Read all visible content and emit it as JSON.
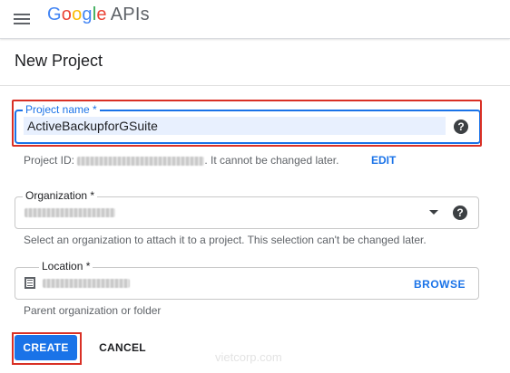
{
  "header": {
    "menu_icon": "hamburger-menu-icon",
    "logo_google": [
      "G",
      "o",
      "o",
      "g",
      "l",
      "e"
    ],
    "logo_suffix": "APIs"
  },
  "page": {
    "title": "New Project"
  },
  "project_name": {
    "label": "Project name *",
    "value": "ActiveBackupforGSuite",
    "help_icon": "help-icon"
  },
  "project_id": {
    "prefix": "Project ID:",
    "suffix": ". It cannot be changed later.",
    "edit_label": "EDIT"
  },
  "organization": {
    "label": "Organization *",
    "hint": "Select an organization to attach it to a project. This selection can't be changed later.",
    "dropdown_icon": "dropdown-arrow-icon",
    "help_icon": "help-icon"
  },
  "location": {
    "label": "Location *",
    "browse_label": "BROWSE",
    "hint": "Parent organization or folder",
    "icon": "building-icon"
  },
  "actions": {
    "create_label": "CREATE",
    "cancel_label": "CANCEL"
  },
  "watermark": "vietcorp.com",
  "colors": {
    "primary": "#1a73e8",
    "highlight_red": "#d93025"
  }
}
